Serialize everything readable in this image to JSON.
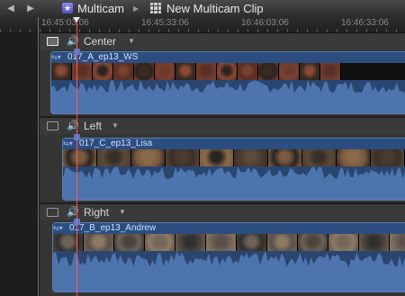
{
  "navbar": {
    "back_icon": "back-arrow-icon",
    "forward_icon": "forward-arrow-icon",
    "breadcrumb_parent": "Multicam",
    "breadcrumb_current": "New Multicam Clip"
  },
  "ruler": {
    "timecodes": [
      "16:45:03:06",
      "16:45:33:06",
      "16:46:03:06",
      "16:46:33:06"
    ]
  },
  "angles": [
    {
      "name": "Center",
      "clip_name": "017_A_ep13_WS",
      "active_video": true
    },
    {
      "name": "Left",
      "clip_name": "017_C_ep13_Lisa",
      "active_video": false
    },
    {
      "name": "Right",
      "clip_name": "017_B_ep13_Andrew",
      "active_video": false
    }
  ],
  "colors": {
    "clip_fill": "#24406b",
    "clip_border": "#5b7fb2",
    "waveform": "#4e74ad",
    "playhead": "#ff5a5a"
  }
}
